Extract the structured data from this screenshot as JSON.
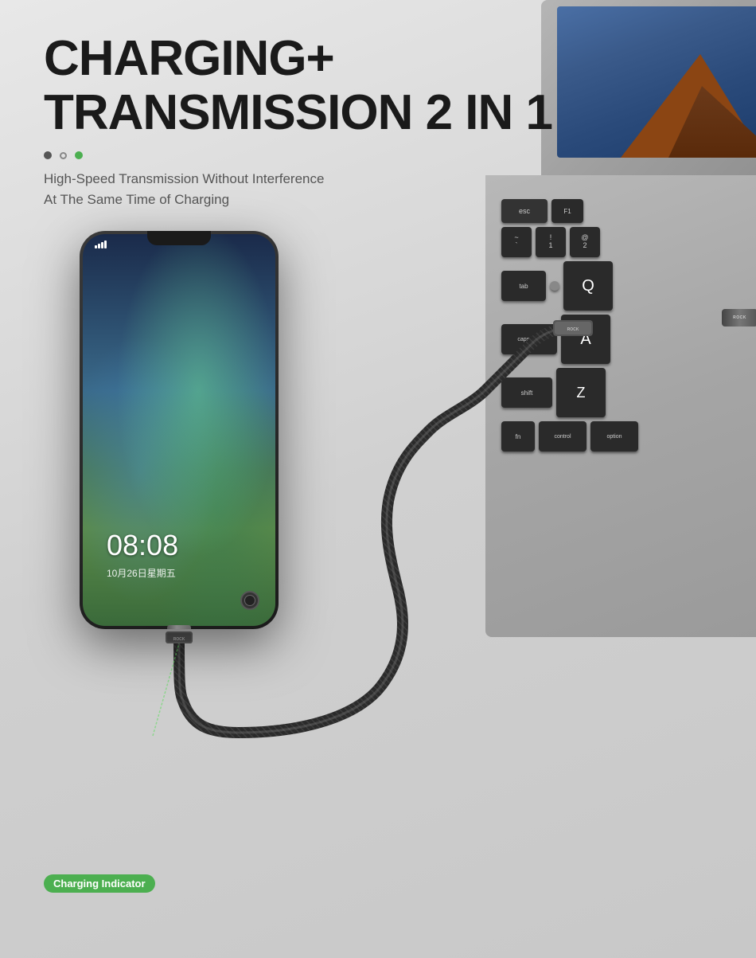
{
  "page": {
    "background_color": "#d5d5d5",
    "title": "Charging + Transmission 2 in 1",
    "title_line1": "CHARGING+",
    "title_line2": "TRANSMISSION 2 IN 1",
    "subtitle_line1": "High-Speed Transmission Without Interference",
    "subtitle_line2": "At The Same Time of Charging",
    "dots": [
      {
        "type": "filled",
        "color": "#555"
      },
      {
        "type": "outline",
        "color": "transparent"
      },
      {
        "type": "filled-green",
        "color": "#4caf50"
      }
    ],
    "charging_indicator": {
      "label": "Charging Indicator",
      "color": "#4caf50"
    },
    "phone": {
      "time": "08:08",
      "date": "10月26日星期五"
    },
    "keyboard_keys": {
      "row1": [
        "esc",
        "F1"
      ],
      "row2": [
        "~\n`",
        "!\n1",
        "@\n2"
      ],
      "row3": [
        "tab",
        "Q"
      ],
      "row4": [
        "caps lock",
        "A"
      ],
      "row5": [
        "shift",
        "Z"
      ],
      "row6": [
        "fn",
        "control",
        "option"
      ]
    },
    "connectors": {
      "brand": "ROCK"
    }
  }
}
